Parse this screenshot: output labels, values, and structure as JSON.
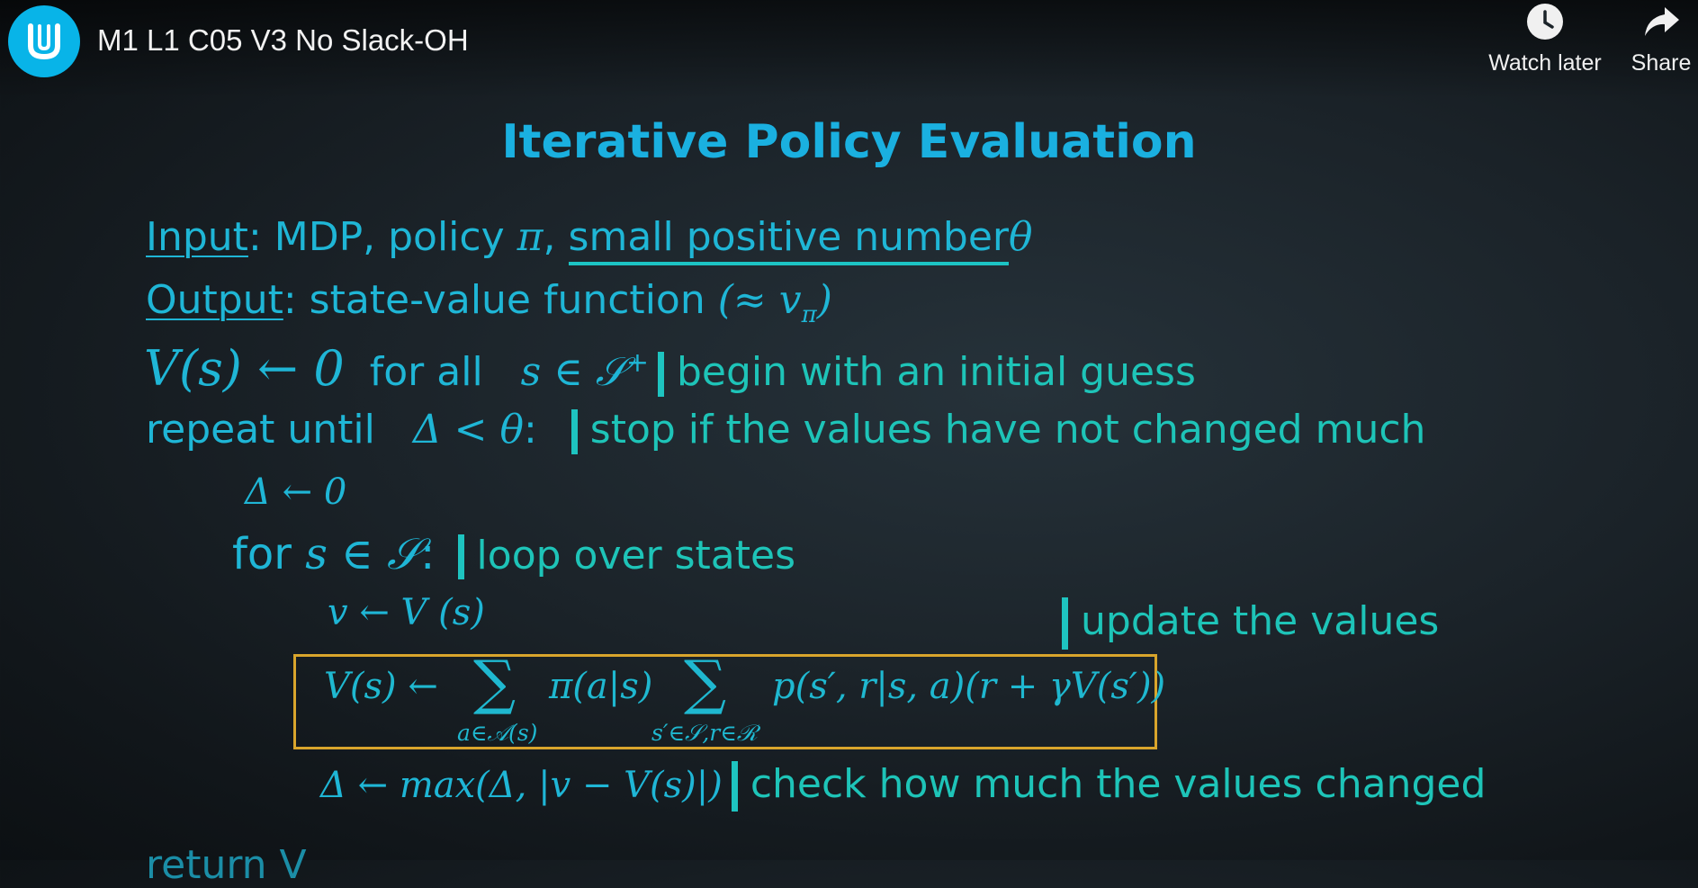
{
  "video": {
    "title": "M1 L1 C05 V3 No Slack-OH"
  },
  "controls": {
    "watch_later": "Watch later",
    "share": "Share"
  },
  "icons": {
    "logo": "udacity-logo-icon",
    "watch_later": "clock-icon",
    "share": "share-arrow-icon"
  },
  "colors": {
    "logo_bg": "#08b4e8",
    "title": "#1ab0e0",
    "text": "#1ec0c4",
    "box": "#d9a52c"
  },
  "slide": {
    "title": "Iterative Policy Evaluation",
    "input_label": "Input",
    "input_text": ": MDP, policy ",
    "input_pi": "π",
    "input_sep": ", ",
    "input_small": "small positive number",
    "input_theta": "θ",
    "output_label": "Output",
    "output_text": ": state-value function ",
    "output_math": "(≈ v",
    "output_sub": "π",
    "output_close": ")",
    "init_math": "V(s) ← 0",
    "init_for_all": "for all",
    "init_set": "s ∈ 𝒮",
    "init_sup": "+",
    "init_comment": "begin with an initial guess",
    "repeat_text": "repeat until",
    "repeat_math": "Δ < θ",
    "repeat_colon": ":",
    "repeat_comment": "stop if the values have not changed much",
    "delta_init": "Δ ← 0",
    "for_text": "for",
    "for_math": "s ∈ 𝒮",
    "for_colon": ":",
    "for_comment": "loop over states",
    "v_assign": "v ← V (s)",
    "update_comment": "update the values",
    "bellman_lhs": "V(s) ←",
    "bellman_sum1": "∑",
    "bellman_sub1": "a∈𝒜(s)",
    "bellman_pi": "π(a|s)",
    "bellman_sum2": "∑",
    "bellman_sub2": "s′∈𝒮,r∈ℛ",
    "bellman_rhs": "p(s′, r|s, a)(r + γV(s′))",
    "delta_update": "Δ ← max(Δ, |v − V(s)|)",
    "delta_comment": "check how much the values changed",
    "return_partial": "return V"
  }
}
